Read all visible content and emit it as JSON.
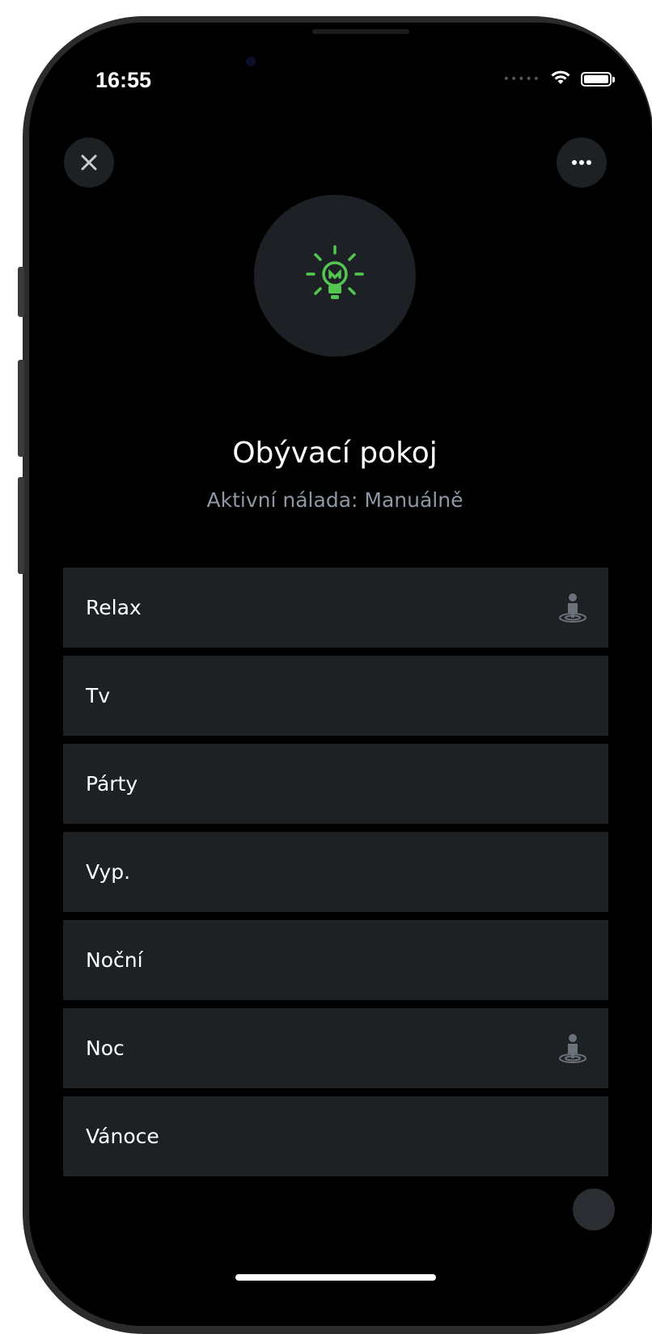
{
  "status_bar": {
    "time": "16:55",
    "icons": [
      "cellular-dots-icon",
      "wifi-icon",
      "battery-icon"
    ]
  },
  "header": {
    "close_icon": "close-icon",
    "more_icon": "more-horizontal-icon"
  },
  "room": {
    "icon": "lightbulb-icon",
    "icon_color": "#53c752",
    "title": "Obývací pokoj",
    "active_mood": "Aktivní nálada: Manuálně"
  },
  "scenes": [
    {
      "label": "Relax",
      "has_person_icon": true
    },
    {
      "label": "Tv",
      "has_person_icon": false
    },
    {
      "label": "Párty",
      "has_person_icon": false
    },
    {
      "label": "Vyp.",
      "has_person_icon": false
    },
    {
      "label": "Noční",
      "has_person_icon": false
    },
    {
      "label": "Noc",
      "has_person_icon": true
    },
    {
      "label": "Vánoce",
      "has_person_icon": false
    }
  ],
  "colors": {
    "background": "#000000",
    "card": "#1e2124",
    "accent": "#53c752",
    "subtitle": "#8e97a3"
  }
}
